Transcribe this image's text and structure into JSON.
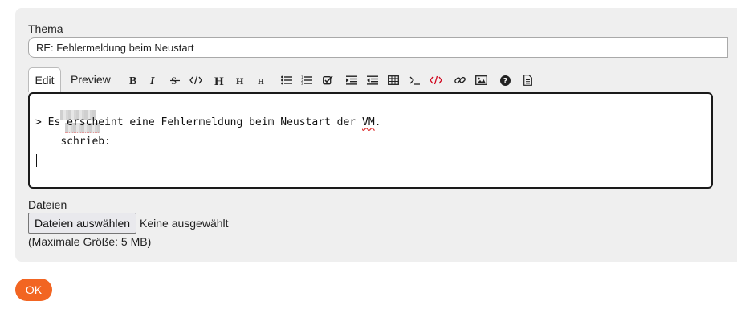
{
  "form": {
    "subject_label": "Thema",
    "subject_value": "RE: Fehlermeldung beim Neustart"
  },
  "editor": {
    "tabs": {
      "edit": "Edit",
      "preview": "Preview"
    },
    "toolbar_icons": [
      "bold-icon",
      "italic-icon",
      "strikethrough-icon",
      "code-icon",
      "heading-1-icon",
      "heading-2-icon",
      "heading-3-icon",
      "bullet-list-icon",
      "numbered-list-icon",
      "task-list-icon",
      "indent-icon",
      "outdent-icon",
      "table-icon",
      "terminal-icon",
      "html-code-icon",
      "link-icon",
      "image-icon",
      "help-icon",
      "document-icon"
    ],
    "line1_suffix": "schrieb:",
    "line2_prefix": "> Es erscheint eine Fehlermeldung beim Neustart der ",
    "line2_word": "VM",
    "line2_end": "."
  },
  "files": {
    "label": "Dateien",
    "button": "Dateien auswählen",
    "status": "Keine ausgewählt",
    "hint": "(Maximale Größe: 5 MB)"
  },
  "submit_label": "OK",
  "colors": {
    "accent": "#f26522",
    "panel": "#efefef",
    "html_icon": "#d0021b"
  }
}
